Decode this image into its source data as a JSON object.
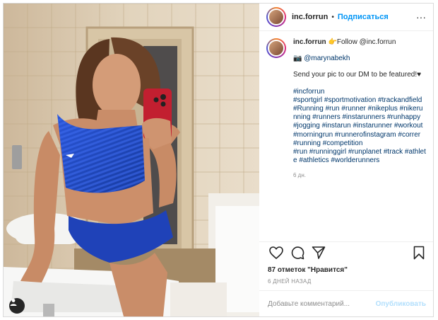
{
  "header": {
    "username": "inc.forrun",
    "separator": "•",
    "follow_label": "Подписаться",
    "more_label": "···"
  },
  "caption": {
    "username": "inc.forrun",
    "line1_emoji": "👉",
    "line1_text": "Follow @inc.forrun",
    "credit_emoji": "📷",
    "credit_text": "@marynabekh",
    "line_dm": "Send your pic to our DM to be featured!♥",
    "hashtags": [
      "#incforrun",
      "#sportgirl #sportmotivation #trackandfield #Running #run #runner #nikeplus #nikerunning #runners #instarunners #runhappy #jogging #instarun #instarunner #workout #morningrun #runnerofinstagram #correr",
      "#running #competition",
      "#run #runninggirl #runplanet #track #athlete #athletics #worlderunners"
    ],
    "time_ago": "6 дн."
  },
  "actions": {
    "like_icon": "heart-icon",
    "comment_icon": "comment-icon",
    "share_icon": "share-icon",
    "save_icon": "bookmark-icon"
  },
  "likes": {
    "count_text": "87 отметок",
    "quote_text": "\"Нравится\""
  },
  "date_text": "6 ДНЕЙ НАЗАД",
  "comment": {
    "placeholder": "Добавьте комментарий...",
    "publish_label": "Опубликовать"
  },
  "colors": {
    "link_blue": "#0095f6",
    "hashtag": "#00376b",
    "muted": "#8e8e8e",
    "publish_disabled": "#b2dffc"
  }
}
